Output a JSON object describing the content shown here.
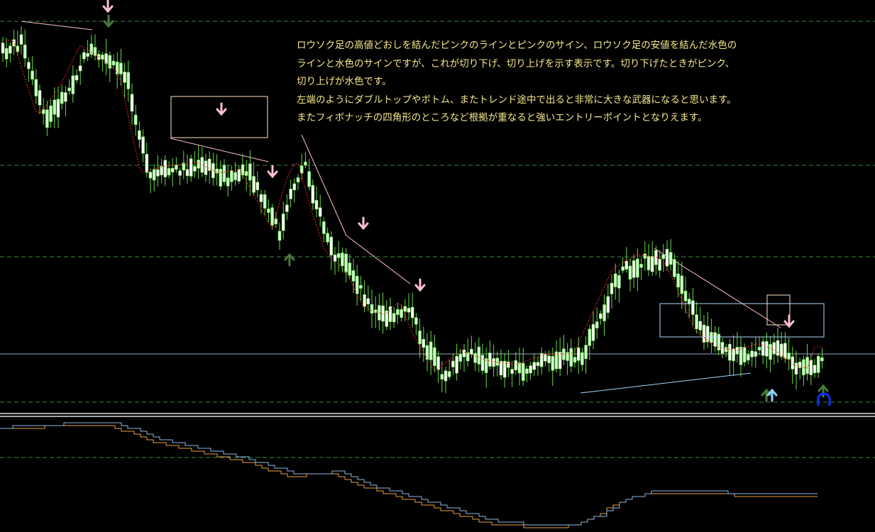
{
  "annotation": {
    "lines": [
      "ロウソク足の高値どおしを結んだピンクのラインとピンクのサイン、ロウソク足の安値を結んだ水色の",
      "ラインと水色のサインですが、これが切り下げ、切り上げを示す表示です。切り下げたときがピンク、",
      "切り上げが水色です。",
      "左端のようにダブルトップやボトム、またトレンド途中で出ると非常に大きな武器になると思います。",
      "またフィボナッチの四角形のところなど根拠が重なると強いエントリーポイントとなりえます。"
    ]
  },
  "colors": {
    "background": "#000000",
    "candle_bull": "#ffffff",
    "candle_bear": "#ccffcc",
    "wick": "#66dd44",
    "ma_line": "#ff2222",
    "grid_dash": "#3a8a3a",
    "pink_line": "#ffc0cb",
    "aqua_line": "#9fd8ff",
    "fibo_box": "#ffe4c4",
    "fibo_box2": "#b0d8ff",
    "horizontal_level": "#8fa8c8",
    "osc_orange": "#e8a040",
    "osc_blue": "#8fb8e0",
    "arrow_pink": "#ffc0d0",
    "arrow_aqua": "#8fd0ff",
    "arrow_green": "#4a7a3a",
    "arrow_dark_blue": "#1030ff"
  },
  "icons": [
    "pink-down-arrow-icon",
    "aqua-up-arrow-icon",
    "green-arrow-icon",
    "blue-stop-icon"
  ]
}
